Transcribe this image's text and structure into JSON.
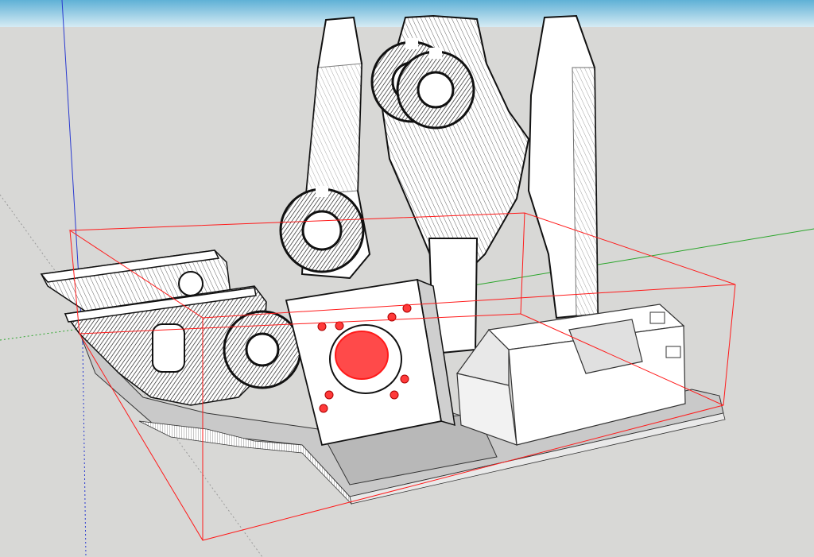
{
  "viewport": {
    "sky_gradient_top": "#5fb1d6",
    "sky_gradient_bottom": "#d6ebf4",
    "ground_color": "#d8d8d6",
    "axis_red": "#e02020",
    "axis_green": "#2aa52a",
    "axis_blue": "#2a3ad0",
    "selection_color": "#ff1a1a",
    "model_fill": "#ffffff",
    "model_edge": "#111111",
    "shadow_face": "#b8b8b8"
  }
}
